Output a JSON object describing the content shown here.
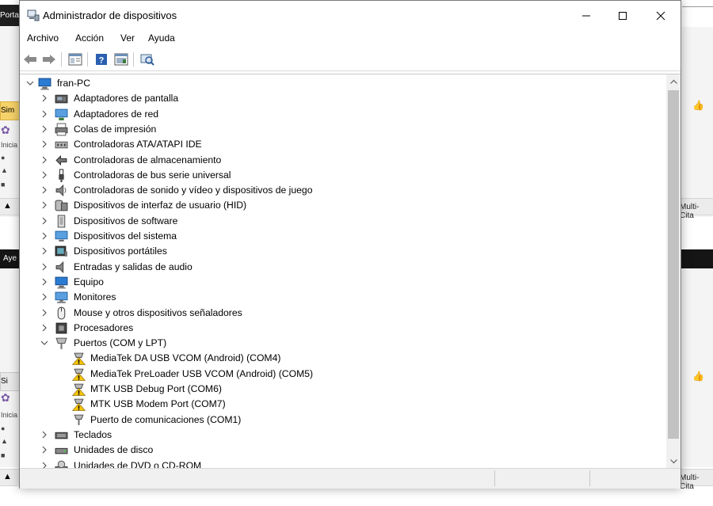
{
  "background": {
    "tab_left_top": "Porta",
    "tab_sim_1": "Sim",
    "tab_sim_2": "Si",
    "band_left": "Aye",
    "iniciar_1": "Inicia",
    "iniciar_2": "Inicia",
    "multi_1": "Multi-Cita",
    "multi_2": "Multi-Cita",
    "warn_1": "▲",
    "warn_2": "▲"
  },
  "window": {
    "title": "Administrador de dispositivos",
    "minimize_symbol": "—",
    "maximize_symbol": "☐",
    "close_symbol": "✕"
  },
  "menu": {
    "items": [
      "Archivo",
      "Acción",
      "Ver",
      "Ayuda"
    ]
  },
  "toolbar": {
    "buttons": [
      "back-icon",
      "forward-icon",
      "properties-icon",
      "help-icon",
      "update-driver-icon",
      "scan-hardware-icon"
    ]
  },
  "tree": {
    "root": "fran-PC",
    "categories": [
      {
        "label": "Adaptadores de pantalla",
        "icon": "display-adapter-icon"
      },
      {
        "label": "Adaptadores de red",
        "icon": "network-adapter-icon"
      },
      {
        "label": "Colas de impresión",
        "icon": "printer-icon"
      },
      {
        "label": "Controladoras ATA/ATAPI IDE",
        "icon": "ide-controller-icon"
      },
      {
        "label": "Controladoras de almacenamiento",
        "icon": "storage-controller-icon"
      },
      {
        "label": "Controladoras de bus serie universal",
        "icon": "usb-icon"
      },
      {
        "label": "Controladoras de sonido y vídeo y dispositivos de juego",
        "icon": "speaker-icon"
      },
      {
        "label": "Dispositivos de interfaz de usuario (HID)",
        "icon": "hid-icon"
      },
      {
        "label": "Dispositivos de software",
        "icon": "software-device-icon"
      },
      {
        "label": "Dispositivos del sistema",
        "icon": "system-device-icon"
      },
      {
        "label": "Dispositivos portátiles",
        "icon": "portable-device-icon"
      },
      {
        "label": "Entradas y salidas de audio",
        "icon": "audio-io-icon"
      },
      {
        "label": "Equipo",
        "icon": "computer-icon"
      },
      {
        "label": "Monitores",
        "icon": "monitor-icon"
      },
      {
        "label": "Mouse y otros dispositivos señaladores",
        "icon": "mouse-icon"
      },
      {
        "label": "Procesadores",
        "icon": "processor-icon"
      },
      {
        "label": "Puertos (COM y LPT)",
        "icon": "port-icon",
        "expanded": true
      }
    ],
    "ports": [
      {
        "label": "MediaTek DA USB VCOM (Android) (COM4)",
        "warning": true
      },
      {
        "label": "MediaTek PreLoader USB VCOM (Android) (COM5)",
        "warning": true
      },
      {
        "label": "MTK USB Debug Port (COM6)",
        "warning": true
      },
      {
        "label": "MTK USB Modem Port (COM7)",
        "warning": true
      },
      {
        "label": "Puerto de comunicaciones (COM1)",
        "warning": false
      }
    ],
    "after": [
      {
        "label": "Teclados",
        "icon": "keyboard-icon"
      },
      {
        "label": "Unidades de disco",
        "icon": "disk-drive-icon"
      },
      {
        "label": "Unidades de DVD o CD-ROM",
        "icon": "dvd-icon"
      }
    ]
  },
  "colors": {
    "warning": "#f5c400",
    "icon_blue": "#2a7bd4",
    "selection": "#cce8ff"
  }
}
